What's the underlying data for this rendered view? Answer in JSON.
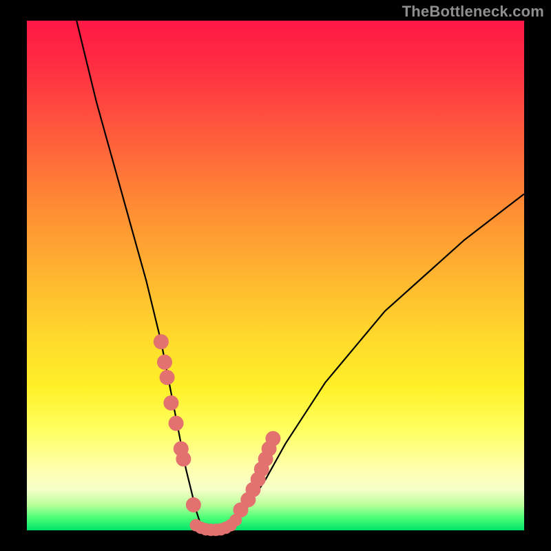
{
  "watermark": "TheBottleneck.com",
  "chart_data": {
    "type": "line",
    "title": "",
    "xlabel": "",
    "ylabel": "",
    "xlim": [
      0,
      100
    ],
    "ylim": [
      0,
      100
    ],
    "series": [
      {
        "name": "curve",
        "x": [
          10,
          12,
          14,
          16,
          18,
          20,
          22,
          24,
          26,
          27,
          28,
          29,
          30,
          31,
          32,
          33,
          34,
          35,
          36,
          37,
          39,
          41,
          44,
          48,
          52,
          56,
          60,
          66,
          72,
          80,
          88,
          96,
          100
        ],
        "y": [
          100,
          92,
          84,
          77,
          70,
          63,
          56,
          49,
          41,
          37,
          32,
          27,
          22,
          17,
          12,
          8,
          4,
          1,
          0,
          0,
          0,
          1,
          4,
          10,
          17,
          23,
          29,
          36,
          43,
          50,
          57,
          63,
          66
        ]
      },
      {
        "name": "left-dots",
        "x": [
          27.0,
          27.7,
          28.2,
          29.0,
          30.0,
          31.0,
          31.5,
          33.5
        ],
        "y": [
          37,
          33,
          30,
          25,
          21,
          16,
          14,
          5
        ]
      },
      {
        "name": "right-dots",
        "x": [
          43.0,
          44.5,
          45.5,
          46.5,
          47.2,
          48.0,
          48.7,
          49.5
        ],
        "y": [
          4,
          6,
          8,
          10,
          12,
          14,
          16,
          18
        ]
      },
      {
        "name": "bottom-dots",
        "x": [
          34.0,
          35.0,
          36.0,
          37.0,
          38.0,
          39.0,
          40.0,
          41.0,
          42.0
        ],
        "y": [
          1,
          0.5,
          0.2,
          0.1,
          0.1,
          0.2,
          0.5,
          1,
          2
        ]
      }
    ],
    "colors": {
      "curve": "#000000",
      "dots": "#e2716f"
    }
  }
}
